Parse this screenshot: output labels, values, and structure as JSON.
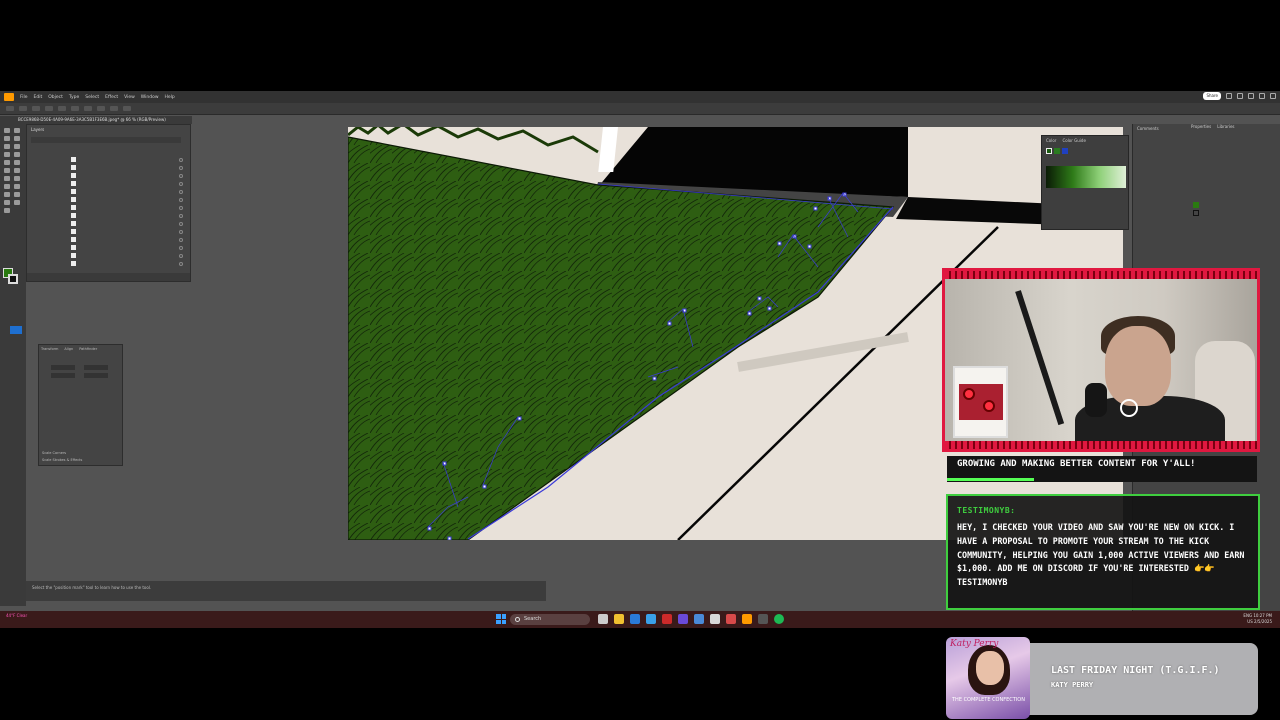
{
  "app": {
    "menu_items": [
      "File",
      "Edit",
      "Object",
      "Type",
      "Select",
      "Effect",
      "View",
      "Window",
      "Help"
    ],
    "document_tab": "BCCE9868-D50E-4A09-9A6E-3A3C5B1F3E6B.jpeg* @ 66 % (RGB/Preview)",
    "share_label": "Share",
    "panel_tabs": {
      "transform": "Transform",
      "align": "Align",
      "pathfinder": "Pathfinder",
      "properties": "Properties",
      "libraries": "Libraries",
      "layers": "Layers",
      "color": "Color",
      "color_guide": "Color Guide",
      "comments": "Comments",
      "scale_corners": "Scale Corners",
      "scale_strokes": "Scale Strokes & Effects"
    },
    "status_text": "Select the \"position mark\" tool to learn how to use the tool."
  },
  "taskbar": {
    "search_placeholder": "Search",
    "weather": "44°F Clear",
    "language": "ENG",
    "region": "US",
    "time": "10:27 PM",
    "date": "2/5/2025"
  },
  "stream": {
    "goal_text": "GROWING AND MAKING BETTER CONTENT FOR Y'ALL!",
    "goal_progress": 0.28,
    "chat_user": "TESTIMONYB:",
    "chat_message": "HEY, I CHECKED YOUR VIDEO AND SAW YOU'RE NEW ON KICK. I HAVE A PROPOSAL TO PROMOTE YOUR STREAM TO THE KICK COMMUNITY, HELPING YOU GAIN 1,000 ACTIVE VIEWERS AND EARN $1,000. ADD ME ON DISCORD IF YOU'RE INTERESTED 👉👉 TESTIMONYB",
    "now_playing": {
      "title": "LAST FRIDAY NIGHT (T.G.I.F.)",
      "artist": "KATY PERRY",
      "album_art_title": "Katy Perry",
      "album_art_sub": "THE COMPLETE CONFECTION"
    }
  },
  "colors": {
    "grass": "#2e5e12",
    "grass_dark": "#1b3a08",
    "selection": "#3a3ad8",
    "webcam_border": "#e01840",
    "chat_border": "#3fce3f",
    "taskbar": "#3a1a1a"
  }
}
